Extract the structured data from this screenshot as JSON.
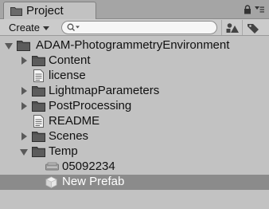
{
  "tab": {
    "title": "Project",
    "icon": "project-folder-icon"
  },
  "tab_tools": {
    "lock_icon": "lock-icon",
    "menu_icon": "menu-icon"
  },
  "toolbar": {
    "create_label": "Create",
    "search_placeholder": "",
    "search_icon": "search-icon",
    "filter_type_icon": "filter-by-type-icon",
    "filter_label_icon": "filter-by-label-icon"
  },
  "tree": {
    "items": [
      {
        "label": "ADAM-PhotogrammetryEnvironment",
        "type": "folder",
        "expanded": true,
        "depth": 0
      },
      {
        "label": "Content",
        "type": "folder",
        "expanded": false,
        "depth": 1
      },
      {
        "label": "license",
        "type": "file",
        "depth": 1
      },
      {
        "label": "LightmapParameters",
        "type": "folder",
        "expanded": false,
        "depth": 1
      },
      {
        "label": "PostProcessing",
        "type": "folder",
        "expanded": false,
        "depth": 1
      },
      {
        "label": "README",
        "type": "file",
        "depth": 1
      },
      {
        "label": "Scenes",
        "type": "folder",
        "expanded": false,
        "depth": 1
      },
      {
        "label": "Temp",
        "type": "folder",
        "expanded": true,
        "depth": 1
      },
      {
        "label": "05092234",
        "type": "asset",
        "depth": 2
      },
      {
        "label": "New Prefab",
        "type": "prefab",
        "depth": 2,
        "selected": true
      }
    ]
  },
  "colors": {
    "panel_bg": "#c2c2c2",
    "selection_bg": "#8b8b8b",
    "folder": "#4a4a4a"
  }
}
